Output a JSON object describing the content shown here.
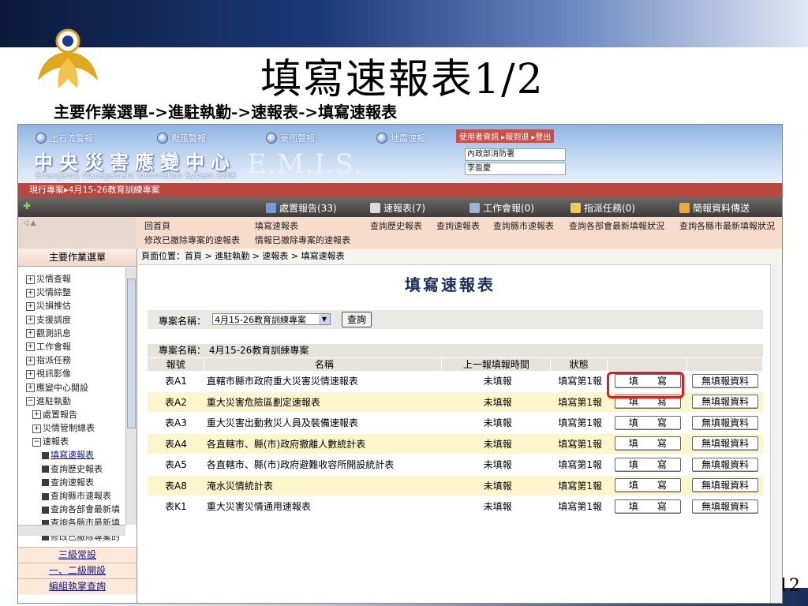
{
  "slide": {
    "title": "填寫速報表1/2",
    "subtitle": "主要作業選單->進駐執勤->速報表->填寫速報表",
    "page_number": "12"
  },
  "app": {
    "radios": [
      "土石流警報",
      "颱風警報",
      "豪雨警報",
      "地震速報"
    ],
    "center_name": "中央災害應變中心",
    "center_en": "Emergency Management Information System EMIS",
    "emis": "E.M.I.S.",
    "user_links": "使用者資訊 ▸報到退 ▸登出",
    "org": "內政部消防署",
    "user_name": "李盈慶",
    "current_project": "現行專案▸4月15-26教育訓練專案"
  },
  "toolbar": {
    "items": [
      "處置報告(33)",
      "速報表(7)",
      "工作會報(0)",
      "指派任務(0)",
      "簡報資料傳送"
    ]
  },
  "menu": {
    "row1": [
      "回首頁",
      "填寫速報表",
      "查詢歷史報表",
      "查詢速報表",
      "查詢縣市速報表",
      "查詢各部會最新填報狀況",
      "查詢各縣市最新填報狀況"
    ],
    "row2": [
      "修改已撤除專案的速報表",
      "情報已撤除專案的速報表"
    ]
  },
  "left": {
    "header": "主要作業選單",
    "tree": [
      {
        "label": "災情查報",
        "type": "plus"
      },
      {
        "label": "災情綜整",
        "type": "plus"
      },
      {
        "label": "災損推估",
        "type": "plus"
      },
      {
        "label": "支援調度",
        "type": "plus"
      },
      {
        "label": "觀測訊息",
        "type": "plus"
      },
      {
        "label": "工作會報",
        "type": "plus"
      },
      {
        "label": "指派任務",
        "type": "plus"
      },
      {
        "label": "視訊影像",
        "type": "plus"
      },
      {
        "label": "應變中心開設",
        "type": "plus"
      },
      {
        "label": "進駐執勤",
        "type": "minus"
      },
      {
        "label": "處置報告",
        "type": "plus"
      },
      {
        "label": "災情管制總表",
        "type": "plus"
      },
      {
        "label": "速報表",
        "type": "minus"
      },
      {
        "label": "填寫速報表",
        "type": "page"
      },
      {
        "label": "查詢歷史報表",
        "type": "page"
      },
      {
        "label": "查詢速報表",
        "type": "page"
      },
      {
        "label": "查詢縣市速報表",
        "type": "page"
      },
      {
        "label": "查詢各部會最新填",
        "type": "page"
      },
      {
        "label": "查詢各縣市最新填",
        "type": "page"
      },
      {
        "label": "修改已撤除專案的",
        "type": "page"
      }
    ],
    "links": [
      "三級常設",
      "一、二級開設",
      "編組執掌查詢"
    ]
  },
  "main": {
    "breadcrumb": "頁面位置：首頁 > 進駐執勤 > 速報表 > 填寫速報表",
    "title": "填寫速報表",
    "project_label": "專案名稱：",
    "project_value": "4月15-26教育訓練專案",
    "query_button": "查詢",
    "table_project": "專案名稱： 4月15-26教育訓練專案",
    "columns": [
      "報號",
      "名稱",
      "上一報填報時間",
      "狀態",
      "",
      ""
    ],
    "fill_label": "填　　寫",
    "none_label": "無填報資料",
    "rows": [
      {
        "no": "表A1",
        "name": "直轄市縣市政府重大災害災情速報表",
        "last": "未填報",
        "status": "填寫第1報"
      },
      {
        "no": "表A2",
        "name": "重大災害危險區劃定速報表",
        "last": "未填報",
        "status": "填寫第1報"
      },
      {
        "no": "表A3",
        "name": "重大災害出動救災人員及裝備速報表",
        "last": "未填報",
        "status": "填寫第1報"
      },
      {
        "no": "表A4",
        "name": "各直轄市、縣(市)政府撤離人數統計表",
        "last": "未填報",
        "status": "填寫第1報"
      },
      {
        "no": "表A5",
        "name": "各直轄市、縣(市)政府避難收容所開設統計表",
        "last": "未填報",
        "status": "填寫第1報"
      },
      {
        "no": "表A8",
        "name": "淹水災情統計表",
        "last": "未填報",
        "status": "填寫第1報"
      },
      {
        "no": "表K1",
        "name": "重大災害災情通用速報表",
        "last": "未填報",
        "status": "填寫第1報"
      }
    ]
  },
  "colors": {
    "accent_red": "#e01c1c",
    "project_bar": "#b9463f",
    "row_alt": "#fdf5cb"
  }
}
